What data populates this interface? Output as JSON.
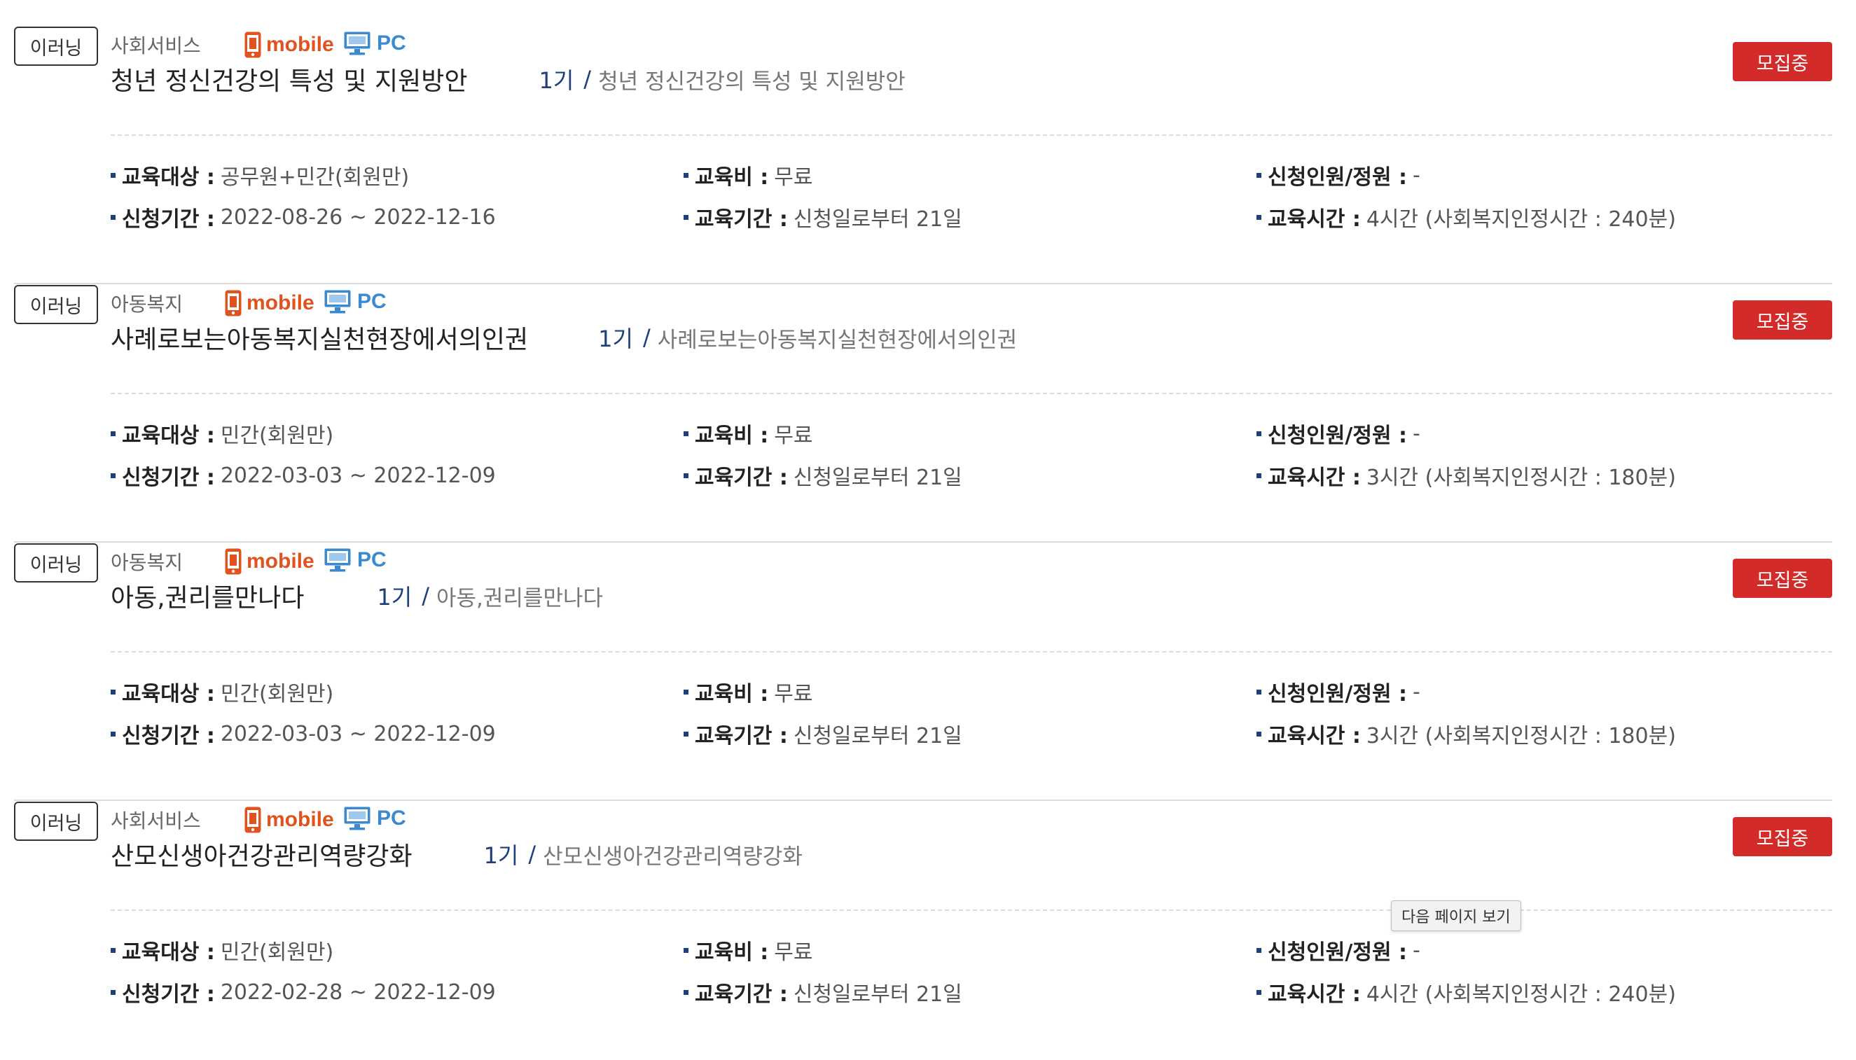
{
  "courses": [
    {
      "type_badge": "이러닝",
      "category": "사회서비스",
      "mobile_label": "mobile",
      "pc_label": "PC",
      "status": "모집중",
      "title": "청년 정신건강의 특성 및 지원방안",
      "session": "1기",
      "separator": "/",
      "session_title": "청년 정신건강의 특성 및 지원방안",
      "target_label": "교육대상 :",
      "target_value": "공무원+민간(회원만)",
      "fee_label": "교육비 :",
      "fee_value": "무료",
      "capacity_label": "신청인원/정원 :",
      "capacity_value": "-",
      "apply_period_label": "신청기간 :",
      "apply_period_value": "2022-08-26 ~ 2022-12-16",
      "edu_period_label": "교육기간 :",
      "edu_period_value": "신청일로부터 21일",
      "edu_time_label": "교육시간 :",
      "edu_time_value": "4시간 (사회복지인정시간 : 240분)"
    },
    {
      "type_badge": "이러닝",
      "category": "아동복지",
      "mobile_label": "mobile",
      "pc_label": "PC",
      "status": "모집중",
      "title": "사례로보는아동복지실천현장에서의인권",
      "session": "1기",
      "separator": "/",
      "session_title": "사례로보는아동복지실천현장에서의인권",
      "target_label": "교육대상 :",
      "target_value": "민간(회원만)",
      "fee_label": "교육비 :",
      "fee_value": "무료",
      "capacity_label": "신청인원/정원 :",
      "capacity_value": "-",
      "apply_period_label": "신청기간 :",
      "apply_period_value": "2022-03-03 ~ 2022-12-09",
      "edu_period_label": "교육기간 :",
      "edu_period_value": "신청일로부터 21일",
      "edu_time_label": "교육시간 :",
      "edu_time_value": "3시간 (사회복지인정시간 : 180분)"
    },
    {
      "type_badge": "이러닝",
      "category": "아동복지",
      "mobile_label": "mobile",
      "pc_label": "PC",
      "status": "모집중",
      "title": "아동,권리를만나다",
      "session": "1기",
      "separator": "/",
      "session_title": "아동,권리를만나다",
      "target_label": "교육대상 :",
      "target_value": "민간(회원만)",
      "fee_label": "교육비 :",
      "fee_value": "무료",
      "capacity_label": "신청인원/정원 :",
      "capacity_value": "-",
      "apply_period_label": "신청기간 :",
      "apply_period_value": "2022-03-03 ~ 2022-12-09",
      "edu_period_label": "교육기간 :",
      "edu_period_value": "신청일로부터 21일",
      "edu_time_label": "교육시간 :",
      "edu_time_value": "3시간 (사회복지인정시간 : 180분)"
    },
    {
      "type_badge": "이러닝",
      "category": "사회서비스",
      "mobile_label": "mobile",
      "pc_label": "PC",
      "status": "모집중",
      "title": "산모신생아건강관리역량강화",
      "session": "1기",
      "separator": "/",
      "session_title": "산모신생아건강관리역량강화",
      "target_label": "교육대상 :",
      "target_value": "민간(회원만)",
      "fee_label": "교육비 :",
      "fee_value": "무료",
      "capacity_label": "신청인원/정원 :",
      "capacity_value": "-",
      "apply_period_label": "신청기간 :",
      "apply_period_value": "2022-02-28 ~ 2022-12-09",
      "edu_period_label": "교육기간 :",
      "edu_period_value": "신청일로부터 21일",
      "edu_time_label": "교육시간 :",
      "edu_time_value": "4시간 (사회복지인정시간 : 240분)"
    }
  ],
  "tooltip": "다음 페이지 보기",
  "colors": {
    "status_bg": "#d32a2a",
    "mobile_orange": "#e0531e",
    "pc_blue": "#3b8ad0",
    "session_navy": "#1f3f7a"
  }
}
